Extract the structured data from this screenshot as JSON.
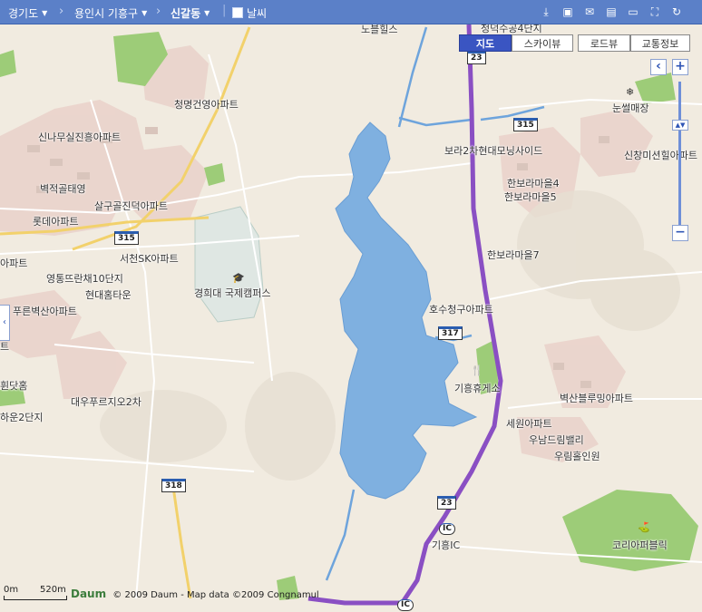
{
  "topbar": {
    "breadcrumb": [
      {
        "label": "경기도"
      },
      {
        "label": "용인시 기흥구"
      },
      {
        "label": "신갈동"
      }
    ],
    "weather_label": "날씨",
    "tools": [
      "download-icon",
      "save-icon",
      "mail-icon",
      "print-icon",
      "ruler-icon",
      "fullscreen-icon",
      "refresh-icon"
    ]
  },
  "map_type": {
    "map": "지도",
    "skyview": "스카이뷰",
    "roadview": "로드뷰",
    "traffic": "교통정보"
  },
  "zoom": {
    "in": "+",
    "out": "−",
    "level_fraction": 0.3
  },
  "labels": {
    "l1": "노블힐스",
    "l2": "청덕수공4단지",
    "l3": "청명건영아파트",
    "l4": "신나무실진흥아파트",
    "l5": "벽적골태영",
    "l6": "살구골진덕아파트",
    "l7": "롯데아파트",
    "l8": "서천SK아파트",
    "l9": "아파트",
    "l10": "영통뜨란채10단지",
    "l11": "현대홈타운",
    "l12": "경희대 국제캠퍼스",
    "l13": "푸른벽산아파트",
    "l14": "대우푸르지오2차",
    "l15": "휜닷홈",
    "l16": "하운2단지",
    "l17": "눈썰매장",
    "l18": "보라2차현대모닝사이드",
    "l19": "신창미션힐아파트",
    "l20": "한보라마을4",
    "l21": "한보라마을5",
    "l22": "한보라마을7",
    "l23": "호수청구아파트",
    "l24": "기흥휴게소",
    "l25": "벽산블루밍아파트",
    "l26": "세원아파트",
    "l27": "우남드림밸리",
    "l28": "우림홀인원",
    "l29": "기흥IC",
    "l30": "코리아퍼블릭",
    "l31": "트"
  },
  "shields": {
    "r315a": "315",
    "r315b": "315",
    "r23a": "23",
    "r23b": "23",
    "r317": "317",
    "r318": "318",
    "ic1": "IC",
    "ic2": "IC"
  },
  "scale": {
    "start": "0m",
    "end": "520m"
  },
  "copyright": {
    "logo": "Daum",
    "text": "© 2009 Daum - Map data ©2009 Congnamul"
  }
}
